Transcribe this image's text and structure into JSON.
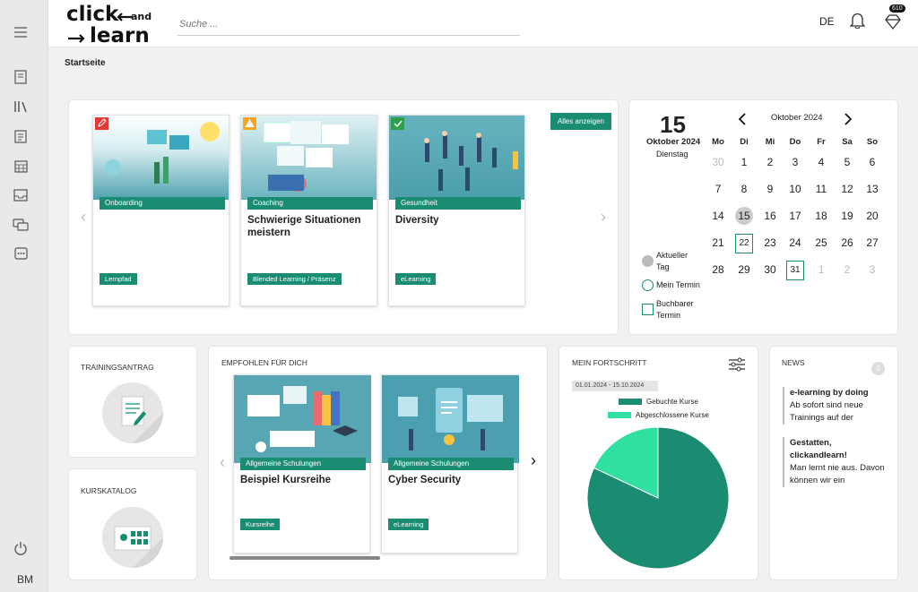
{
  "sidebar": {
    "menu_icon": "hamburger-icon",
    "items": [
      "book-icon",
      "library-icon",
      "clipboard-icon",
      "calendar-icon",
      "inbox-icon",
      "chat-icon",
      "more-icon"
    ],
    "power_icon": "power-icon",
    "user_initials": "BM"
  },
  "header": {
    "logo_line1": "click",
    "logo_and": "and",
    "logo_line2": "learn",
    "search_placeholder": "Suche ...",
    "language": "DE",
    "gem_badge": "610"
  },
  "breadcrumb": "Startseite",
  "courses": {
    "show_all_label": "Alles anzeigen",
    "items": [
      {
        "category": "Onboarding",
        "title": "",
        "type": "Lernpfad",
        "flag_color": "#e53935"
      },
      {
        "category": "Coaching",
        "title": "Schwierige Situationen meistern",
        "type": "Blended Learning / Präsenz",
        "flag_color": "#f5a623"
      },
      {
        "category": "Gesundheit",
        "title": "Diversity",
        "type": "eLearning",
        "flag_color": "#2e9e4f"
      }
    ]
  },
  "calendar": {
    "day": "15",
    "month_year": "Oktober 2024",
    "weekday": "Dienstag",
    "nav_title": "Oktober 2024",
    "headers": [
      "Mo",
      "Di",
      "Mi",
      "Do",
      "Fr",
      "Sa",
      "So"
    ],
    "weeks": [
      [
        "30",
        "1",
        "2",
        "3",
        "4",
        "5",
        "6"
      ],
      [
        "7",
        "8",
        "9",
        "10",
        "11",
        "12",
        "13"
      ],
      [
        "14",
        "15",
        "16",
        "17",
        "18",
        "19",
        "20"
      ],
      [
        "21",
        "22",
        "23",
        "24",
        "25",
        "26",
        "27"
      ],
      [
        "28",
        "29",
        "30",
        "31",
        "1",
        "2",
        "3"
      ]
    ],
    "legend_today": "Aktueller Tag",
    "legend_my": "Mein Termin",
    "legend_bookable": "Buchbarer Termin"
  },
  "training_request": {
    "title": "TRAININGSANTRAG",
    "icon": "document-pen-icon"
  },
  "catalog": {
    "title": "KURSKATALOG",
    "icon": "catalog-grid-icon"
  },
  "recommended": {
    "title": "EMPFOHLEN FÜR DICH",
    "items": [
      {
        "category": "Allgemeine Schulungen",
        "title": "Beispiel Kursreihe",
        "type": "Kursreihe"
      },
      {
        "category": "Allgemeine Schulungen",
        "title": "Cyber Security",
        "type": "eLearning"
      }
    ]
  },
  "progress": {
    "title": "MEIN FORTSCHRITT",
    "date_range": "01.01.2024 - 15.10.2024",
    "legend_booked": "Gebuchte Kurse",
    "legend_done": "Abgeschlossene Kurse",
    "colors": {
      "booked": "#1a8c72",
      "done": "#2fe0a0"
    }
  },
  "chart_data": {
    "type": "pie",
    "categories": [
      "Gebuchte Kurse",
      "Abgeschlossene Kurse"
    ],
    "values": [
      82,
      18
    ]
  },
  "news": {
    "title": "NEWS",
    "count": "0",
    "items": [
      {
        "headline": "e-learning by doing",
        "text": "Ab sofort sind neue Trainings auf der"
      },
      {
        "headline": "Gestatten, clickandlearn!",
        "text": "Man lernt nie aus. Davon können wir ein"
      }
    ]
  }
}
